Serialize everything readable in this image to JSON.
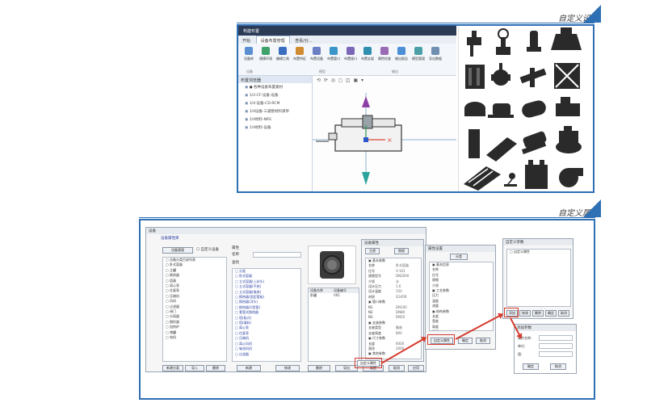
{
  "sections": {
    "top_label": "自定义设备",
    "bottom_label": "自定义属性"
  },
  "colors": {
    "accent": "#2f6fb3",
    "highlight": "#d63b2e",
    "titlebar": "#2b3a55"
  },
  "top_app": {
    "title": "构建布置",
    "tabs": [
      "开始",
      "设备布置管理",
      "查看/分..."
    ],
    "active_tab_index": 1,
    "ribbon_buttons": [
      "设备库",
      "建模环境",
      "编辑工具",
      "布置特征",
      "布置设备",
      "布置管口",
      "布置接口",
      "布置支架",
      "属性检查",
      "输出报告",
      "模型管理",
      "导出数据"
    ],
    "ribbon_groups": [
      "设备",
      "模型",
      "输出"
    ],
    "tree_header": "布置浏览器",
    "tree_items": [
      "● 各种设备布置素材",
      "1/2-CF-设备-设备",
      "1/4-设备-CD-RCM",
      "1/4设备-三通管材料清单",
      "1/4材料-NRS",
      "1/4材料-设备"
    ],
    "viewport_toolbar": "⟲ ⟳ ◎ ◻ ◫ ▣ ▾"
  },
  "bottom_app": {
    "main_title": "设备",
    "main_tab": "设备属性库",
    "manage_button": "设备管理",
    "custom_button": "自定义设备",
    "tree_rows": [
      "▢ 设备分类目录列表",
      "▢ 卧式容器",
      "▢ 立罐",
      "▢ 换热器",
      "▢ 塔器",
      "▢ 离心泵",
      "▢ 往复泵",
      "▢ 压缩机",
      "▢ 风机",
      "▢ 过滤器",
      "▢ 阀门",
      "▢ 分离器",
      "▢ 搅拌器",
      "▢ 加热炉",
      "▢ 储罐",
      "▢ 电机"
    ],
    "left_buttons": [
      "新建分类",
      "导入",
      "删除"
    ],
    "props_title": "属性",
    "name_label": "名称",
    "search_label": "查找",
    "middle_rows": [
      "▢ 分类",
      "▢ 卧式容器",
      "▢ 立式容器(上封头)",
      "▢ 立式容器(平底)",
      "▢ 立式容器(锥底)",
      "▢ 换热器(固定管板)",
      "▢ 换热器(浮头)",
      "▢ 换热器(U型管)",
      "▢ 套管式换热器",
      "▢ 塔(板式)",
      "▢ 塔(填料)",
      "▢ 离心泵",
      "▢ 往复泵",
      "▢ 压缩机",
      "▢ 离心风机",
      "▢ 轴流风机",
      "▢ 过滤器"
    ],
    "middle_buttons": [
      "新建",
      "修改",
      "删除",
      "导出"
    ],
    "table_headers": [
      "设备名称",
      "设备编号"
    ],
    "table_rows": [
      [
        "卧罐",
        "V01"
      ]
    ],
    "attr_title": "设备属性",
    "attr_tabs": [
      "主视",
      "侧视"
    ],
    "attr_rows": [
      "▣ 基本参数",
      "名称",
      "位号",
      "规格型号",
      "介质",
      "设计压力",
      "设计温度",
      "材质",
      "▣ 管口参数",
      "N1",
      "N2",
      "N3",
      "▣ 支座参数",
      "支座类型",
      "支座高度",
      "▣ 尺寸参数",
      "长度",
      "直径",
      "▣ 其他参数"
    ],
    "attr_values": [
      "",
      "卧式容器",
      "V-101",
      "DN2000",
      "水",
      "1.6",
      "150",
      "Q345R",
      "",
      "DN100",
      "DN80",
      "DN50",
      "",
      "鞍座",
      "800",
      "",
      "6000",
      "2000",
      ""
    ],
    "custom_attr_button": "自定义属性",
    "bottom_buttons": [
      "确定",
      "取消",
      "应用",
      "帮助"
    ],
    "third_title": "属性设置",
    "third_tab": "分类",
    "third_rows": [
      "▣ 基本信息",
      "名称",
      "位号",
      "规格",
      "介质",
      "▣ 工艺参数",
      "压力",
      "温度",
      "流量",
      "▣ 结构参数",
      "长度",
      "宽度",
      "高度",
      "重量",
      "▣ 材料参数",
      "材质"
    ],
    "third_values": [
      "",
      "",
      "",
      "",
      "",
      "",
      "",
      "",
      "",
      "",
      "",
      "",
      "",
      "",
      "",
      ""
    ],
    "third_buttons": [
      "自定义属性",
      "确定",
      "取消"
    ],
    "fourth_title": "自定义参数",
    "fourth_rows": [
      "▢ 自定义属性"
    ],
    "fourth_buttons": [
      "添加",
      "修改",
      "删除",
      "确定",
      "取消"
    ],
    "fifth_title": "添加参数",
    "fifth_labels": [
      "属性名称:",
      "单位:",
      "值:"
    ],
    "fifth_buttons": [
      "确定",
      "取消"
    ]
  }
}
